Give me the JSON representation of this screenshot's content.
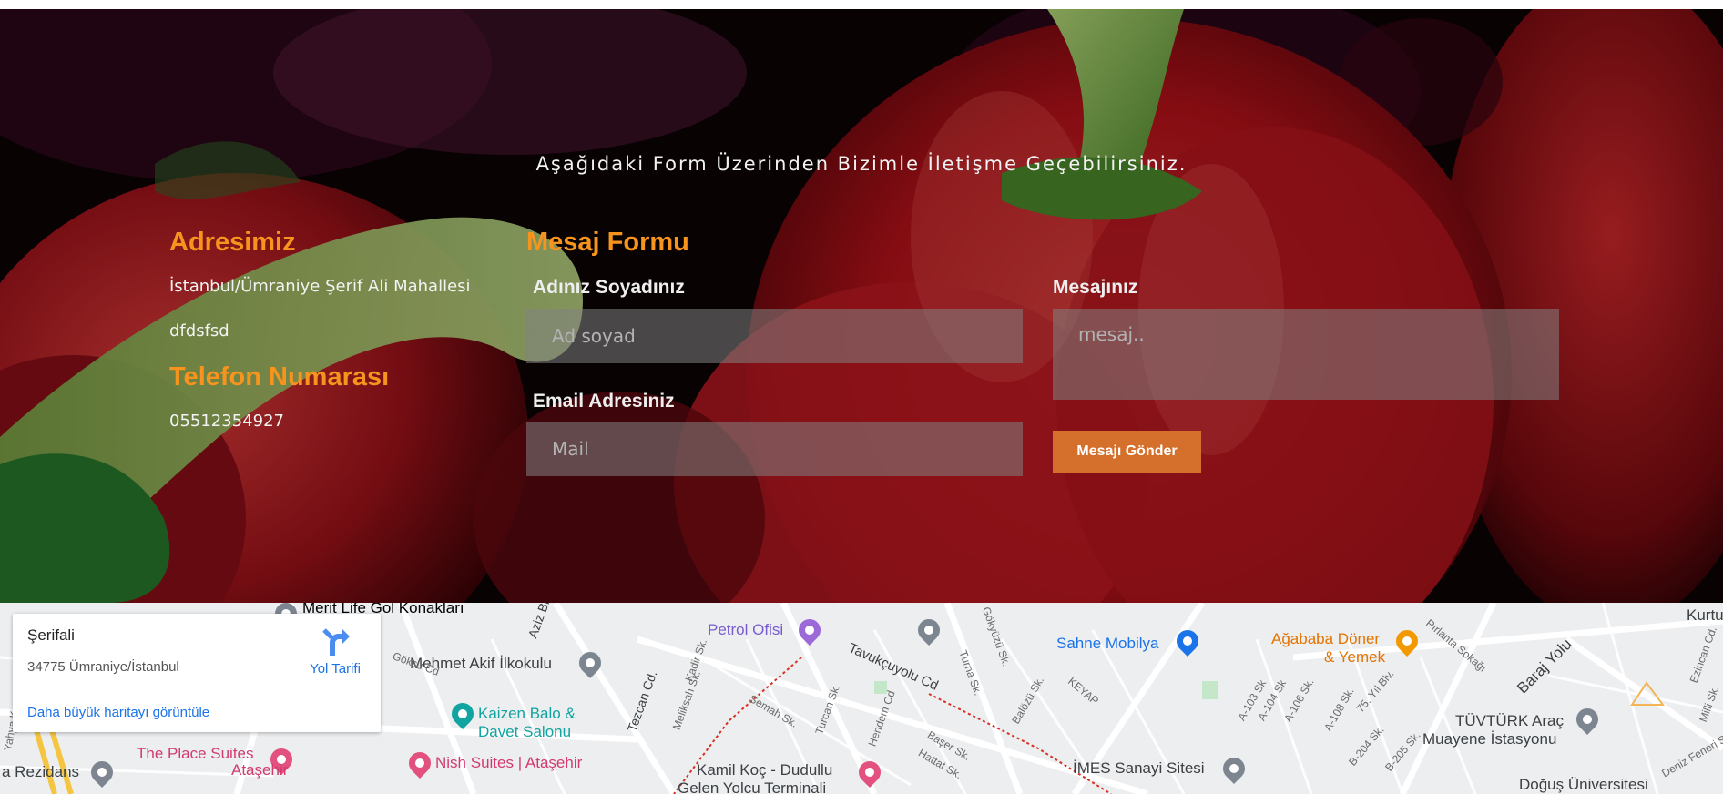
{
  "hero": {
    "subtitle": "Aşağıdaki Form Üzerinden Bizimle İletişme Geçebilirsiniz."
  },
  "contact": {
    "address_title": "Adresimiz",
    "address_line1": "İstanbul/Ümraniye Şerif Ali Mahallesi",
    "address_line2": "dfdsfsd",
    "phone_title": "Telefon Numarası",
    "phone": "05512354927"
  },
  "form": {
    "title": "Mesaj Formu",
    "name_label": "Adınız Soyadınız",
    "name_placeholder": "Ad soyad",
    "email_label": "Email Adresiniz",
    "email_placeholder": "Mail",
    "message_label": "Mesajınız",
    "message_placeholder": "mesaj..",
    "send_label": "Mesajı Gönder"
  },
  "map": {
    "card_title": "Şerifali",
    "card_address": "34775 Ümraniye/İstanbul",
    "directions_label": "Yol Tarifi",
    "larger_map_link": "Daha büyük haritayı görüntüle",
    "places": [
      {
        "name": "Merit Life Gol Konakları",
        "color": "#5f6368"
      },
      {
        "name": "Petrol Ofisi",
        "color": "#7a5ccf"
      },
      {
        "name": "Sahne Mobilya",
        "color": "#1a73e8"
      },
      {
        "name": "Ağababa Döner",
        "color": "#e37400"
      },
      {
        "name": "& Yemek",
        "color": "#e37400"
      },
      {
        "name": "Mehmet Akif İlkokulu",
        "color": "#5f6368"
      },
      {
        "name": "Kaizen Balo &",
        "color": "#12a4a0"
      },
      {
        "name": "Davet Salonu",
        "color": "#12a4a0"
      },
      {
        "name": "The Place Suites",
        "color": "#d23b6f"
      },
      {
        "name": "Ataşehir",
        "color": "#d23b6f"
      },
      {
        "name": "Nish Suites | Ataşehir",
        "color": "#d23b6f"
      },
      {
        "name": "Kamil Koç - Dudullu",
        "color": "#3c4043"
      },
      {
        "name": "Gelen Yolcu Terminali",
        "color": "#3c4043"
      },
      {
        "name": "İMES Sanayi Sitesi",
        "color": "#3c4043"
      },
      {
        "name": "TÜVTÜRK Araç",
        "color": "#3c4043"
      },
      {
        "name": "Muayene İstasyonu",
        "color": "#3c4043"
      },
      {
        "name": "Doğuş Üniversitesi",
        "color": "#3c4043"
      },
      {
        "name": "a Rezidans",
        "color": "#3c4043"
      },
      {
        "name": "Baraj Yolu",
        "color": "#3c4043"
      },
      {
        "name": "Kurtu",
        "color": "#3c4043"
      }
    ],
    "streets": [
      "Tavukçuyolu Cd",
      "Tezcan Cd.",
      "Aziz Bi",
      "Göksu Cd",
      "Meliksah Sk.",
      "Kadir Sk.",
      "Semah Sk.",
      "Turcan Sk.",
      "Hendem Cd",
      "Turna Sk.",
      "Gökyüzü Sk.",
      "Balözü Sk.",
      "KEYAP",
      "Başer Sk.",
      "Hattat Sk.",
      "A-103 Sk",
      "A-104 Sk",
      "A-106 Sk.",
      "A-108 Sk.",
      "75. Yıl Blv.",
      "B-204 Sk.",
      "B-205 Sk.",
      "Pırlanta Sokağı",
      "Ezincan Cd.",
      "Milli Sk.",
      "Deniz Feneri Sk",
      "Yahya Kemal Cd."
    ]
  }
}
